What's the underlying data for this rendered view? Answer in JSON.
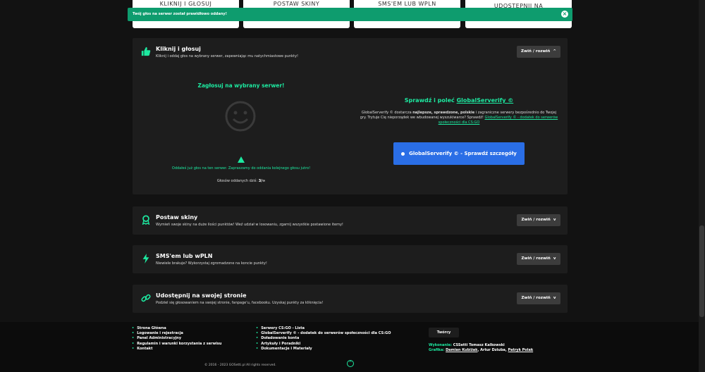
{
  "tabs": [
    {
      "label": "KLIKNIJ I GŁOSUJ"
    },
    {
      "label": "POSTAW SKINY"
    },
    {
      "label": "SMS'EM LUB WPLN"
    },
    {
      "label": "UDOSTĘPNIJ NA"
    }
  ],
  "toast": {
    "message": "Twój głos na serwer został prawidłowo oddany!"
  },
  "vote_card": {
    "title": "Kliknij i głosuj",
    "subtitle": "Kliknij i oddaj głos na wybrany serwer, zapewniając mu natychmiastowe punkty!",
    "toggle": "Zwiń / rozwiń",
    "vote_title": "Zagłosuj na wybrany serwer!",
    "voted_message": "Oddałeś już głos na ten serwer. Zapraszamy do oddania kolejnego głosu jutro!",
    "votes_label": "Głosów oddanych dziś:",
    "votes_value": "3/∞",
    "gs_title_prefix": "Sprawdź i poleć",
    "gs_title_link": "GlobalServerify ©",
    "gs_desc_1": "GlobalServerify © dostarcza",
    "gs_desc_bold": "najlepsze, sprawdzone, polskie",
    "gs_desc_2": "i zagraniczne serwery bezpośrednio do Twojej gry. Trytuje Cię nieporządek we wbudowanej wyszukiwarce? Sprawdź!",
    "gs_desc_link": "GlobalServerify © - dodatek do serwerów społeczności dla CS:GO",
    "gs_button": "GlobalServerify © - Sprawdź szczegóły"
  },
  "cards": [
    {
      "title": "Postaw skiny",
      "subtitle": "Wymień swoje skiny na duże ilości punktów! Weź udział w losowaniu, zgarnij wszystkie postawione itemy!",
      "toggle": "Zwiń / rozwiń"
    },
    {
      "title": "SMS'em lub wPLN",
      "subtitle": "Niewiele brakuje? Wykorzystaj zgromadzone na koncie punkty!",
      "toggle": "Zwiń / rozwiń"
    },
    {
      "title": "Udostępnij na swojej stronie",
      "subtitle": "Podziel się głosowaniem na swojej stronie, fanpage'u, facebooku. Uzyskaj punkty za kliknięcia!",
      "toggle": "Zwiń / rozwiń"
    }
  ],
  "footer": {
    "col1": [
      "Strona Główna",
      "Logowanie i rejestracja",
      "Panel Administracyjny",
      "Regulamin i warunki korzystania z serwisu",
      "Kontakt"
    ],
    "col2": [
      "Serwery CS:GO - Lista",
      "GlobalServerify © - dodatek do serwerów społeczności dla CS:GO",
      "Doładowanie konta",
      "Artykuły i Poradniki",
      "Dokumentacje i Materiały"
    ],
    "authors_button": "Twórcy",
    "made_label": "Wykonanie:",
    "made_value": "CSSetti Tomasz Kalkowski",
    "graphics_label": "Grafika:",
    "graphics_1": "Damian Kubiżak",
    "graphics_2": "Artur Dziuba",
    "graphics_3": "Patryk Polak",
    "copyright": "© 2016 - 2023 GOSetti.pl All rights reserved."
  },
  "colors": {
    "accent": "#1de9a0",
    "toast": "#0e9c6e",
    "button": "#2a6ee6",
    "card": "#1d1d1d",
    "page": "#121212"
  }
}
